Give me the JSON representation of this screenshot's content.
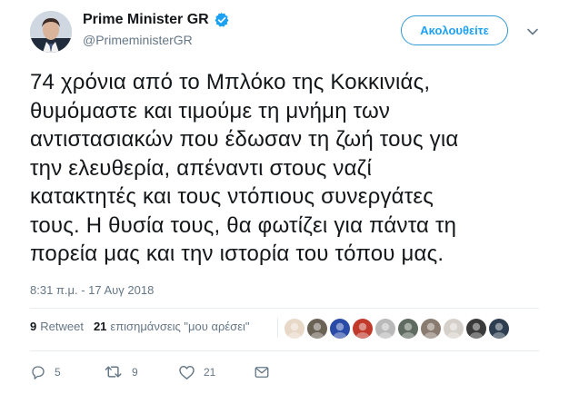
{
  "author": {
    "display_name": "Prime Minister GR",
    "handle": "@PrimeministerGR",
    "verified": true,
    "avatar_icon": "profile-photo"
  },
  "follow_button": {
    "label": "Ακολουθείτε"
  },
  "menu_caret_icon": "chevron-down-icon",
  "tweet": {
    "text": "74 χρόνια από το Μπλόκο της Κοκκινιάς,\nθυμόμαστε και τιμούμε τη μνήμη των\nαντιστασιακών που έδωσαν τη ζωή τους για\nτην ελευθερία, απέναντι στους ναζί\nκατακτητές και τους ντόπιους συνεργάτες\nτους. Η θυσία τους, θα φωτίζει για πάντα τη\nπορεία μας και την ιστορία του τόπου μας.",
    "timestamp": "8:31 π.μ. - 17 Αυγ 2018"
  },
  "stats": {
    "retweets_count": "9",
    "retweets_label": "Retweet",
    "likes_count": "21",
    "likes_label": "επισημάνσεις \"μου αρέσει\""
  },
  "likers": [
    {
      "icon": "liker-avatar-1",
      "color": "#e8d8c8"
    },
    {
      "icon": "liker-avatar-2",
      "color": "#6b6256"
    },
    {
      "icon": "liker-avatar-3",
      "color": "#2a4aa8"
    },
    {
      "icon": "liker-avatar-4",
      "color": "#c0392b"
    },
    {
      "icon": "liker-avatar-5",
      "color": "#b9b9b9"
    },
    {
      "icon": "liker-avatar-6",
      "color": "#5f6b60"
    },
    {
      "icon": "liker-avatar-7",
      "color": "#8a7b70"
    },
    {
      "icon": "liker-avatar-8",
      "color": "#d6d0ca"
    },
    {
      "icon": "liker-avatar-9",
      "color": "#3a3a3a"
    },
    {
      "icon": "liker-avatar-10",
      "color": "#2c3e50"
    }
  ],
  "actions": {
    "reply_count": "5",
    "retweet_count": "9",
    "like_count": "21"
  },
  "colors": {
    "accent": "#1da1f2",
    "text": "#14171a",
    "secondary": "#657786",
    "divider": "#e6ecf0"
  }
}
